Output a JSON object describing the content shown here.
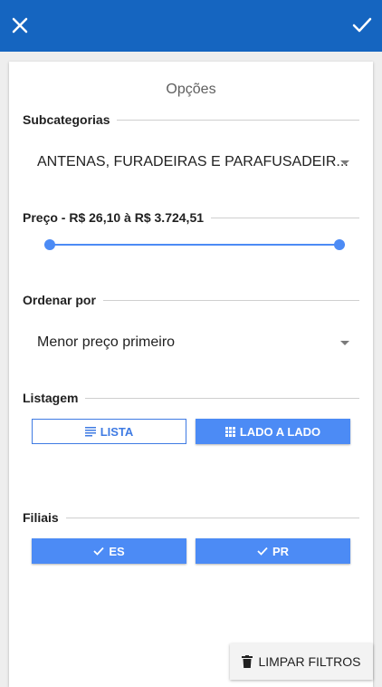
{
  "header": {
    "close_icon": "close-icon",
    "confirm_icon": "check-icon",
    "background_color": "#1565c0"
  },
  "panel": {
    "title": "Opções"
  },
  "subcategorias": {
    "heading": "Subcategorias",
    "selected": "ANTENAS, FURADEIRAS E PARAFUSADEIR..."
  },
  "preco": {
    "heading": "Preço - R$ 26,10 à R$ 3.724,51",
    "range_min_fraction": 0,
    "range_max_fraction": 1
  },
  "ordenar": {
    "heading": "Ordenar por",
    "selected": "Menor preço primeiro"
  },
  "listagem": {
    "heading": "Listagem",
    "lista_label": "LISTA",
    "lado_label": "LADO A LADO",
    "active": "LADO A LADO"
  },
  "filiais": {
    "heading": "Filiais",
    "items": [
      {
        "label": "ES",
        "selected": true
      },
      {
        "label": "PR",
        "selected": true
      }
    ]
  },
  "footer": {
    "clear_label": "LIMPAR FILTROS"
  },
  "colors": {
    "accent": "#4c8bf5",
    "header": "#1565c0"
  }
}
